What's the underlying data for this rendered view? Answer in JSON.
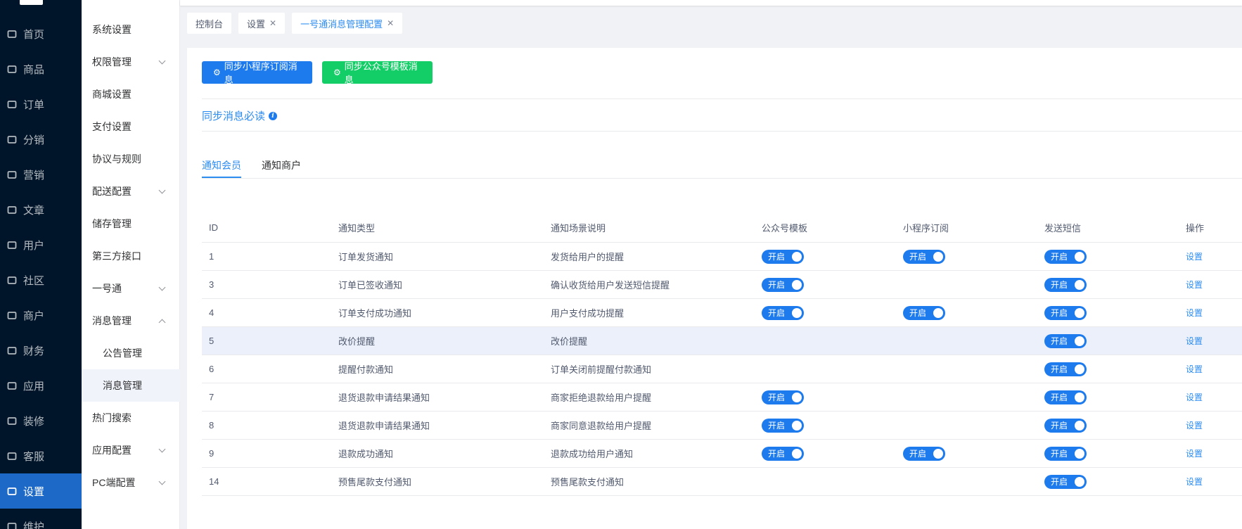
{
  "sidebar_main": [
    {
      "label": "首页",
      "icon": "home-icon"
    },
    {
      "label": "商品",
      "icon": "bag-icon"
    },
    {
      "label": "订单",
      "icon": "order-icon"
    },
    {
      "label": "分销",
      "icon": "send-icon"
    },
    {
      "label": "营销",
      "icon": "flag-icon"
    },
    {
      "label": "文章",
      "icon": "book-icon"
    },
    {
      "label": "用户",
      "icon": "user-icon"
    },
    {
      "label": "社区",
      "icon": "community-icon"
    },
    {
      "label": "商户",
      "icon": "store-icon"
    },
    {
      "label": "财务",
      "icon": "chart-icon"
    },
    {
      "label": "应用",
      "icon": "apps-icon"
    },
    {
      "label": "装修",
      "icon": "brush-icon"
    },
    {
      "label": "客服",
      "icon": "service-icon"
    },
    {
      "label": "设置",
      "icon": "gear-icon",
      "active": true
    },
    {
      "label": "维护",
      "icon": "maintain-icon"
    }
  ],
  "sidebar_sub": [
    {
      "label": "系统设置"
    },
    {
      "label": "权限管理",
      "chevron": "down"
    },
    {
      "label": "商城设置"
    },
    {
      "label": "支付设置"
    },
    {
      "label": "协议与规则"
    },
    {
      "label": "配送配置",
      "chevron": "down"
    },
    {
      "label": "储存管理"
    },
    {
      "label": "第三方接口"
    },
    {
      "label": "一号通",
      "chevron": "down"
    },
    {
      "label": "消息管理",
      "chevron": "up"
    },
    {
      "label": "公告管理",
      "sub": true
    },
    {
      "label": "消息管理",
      "sub": true,
      "active": true
    },
    {
      "label": "热门搜索"
    },
    {
      "label": "应用配置",
      "chevron": "down"
    },
    {
      "label": "PC端配置",
      "chevron": "down"
    }
  ],
  "tabs": [
    {
      "label": "控制台",
      "closable": false
    },
    {
      "label": "设置",
      "closable": true
    },
    {
      "label": "一号通消息管理配置",
      "closable": true,
      "active": true
    }
  ],
  "buttons": {
    "sync_mini": "同步小程序订阅消息",
    "sync_official": "同步公众号模板消息"
  },
  "must_read": "同步消息必读",
  "notify_tabs": [
    "通知会员",
    "通知商户"
  ],
  "table": {
    "headers": [
      "ID",
      "通知类型",
      "通知场景说明",
      "公众号模板",
      "小程序订阅",
      "发送短信",
      "操作"
    ],
    "switch_label": "开启",
    "action_label": "设置",
    "rows": [
      {
        "id": "1",
        "type": "订单发货通知",
        "desc": "发货给用户的提醒",
        "wechat": true,
        "mini": true,
        "sms": true
      },
      {
        "id": "3",
        "type": "订单已签收通知",
        "desc": "确认收货给用户发送短信提醒",
        "wechat": true,
        "mini": false,
        "sms": true
      },
      {
        "id": "4",
        "type": "订单支付成功通知",
        "desc": "用户支付成功提醒",
        "wechat": true,
        "mini": true,
        "sms": true
      },
      {
        "id": "5",
        "type": "改价提醒",
        "desc": "改价提醒",
        "wechat": false,
        "mini": false,
        "sms": true,
        "highlight": true
      },
      {
        "id": "6",
        "type": "提醒付款通知",
        "desc": "订单关闭前提醒付款通知",
        "wechat": false,
        "mini": false,
        "sms": true
      },
      {
        "id": "7",
        "type": "退货退款申请结果通知",
        "desc": "商家拒绝退款给用户提醒",
        "wechat": true,
        "mini": false,
        "sms": true
      },
      {
        "id": "8",
        "type": "退货退款申请结果通知",
        "desc": "商家同意退款给用户提醒",
        "wechat": true,
        "mini": false,
        "sms": true
      },
      {
        "id": "9",
        "type": "退款成功通知",
        "desc": "退款成功给用户通知",
        "wechat": true,
        "mini": true,
        "sms": true
      },
      {
        "id": "14",
        "type": "预售尾款支付通知",
        "desc": "预售尾款支付通知",
        "wechat": false,
        "mini": false,
        "sms": true
      }
    ]
  },
  "colors": {
    "primary": "#1d7bee",
    "success": "#13ce66",
    "sidebar": "#001529",
    "active_menu": "#1d69c8"
  }
}
